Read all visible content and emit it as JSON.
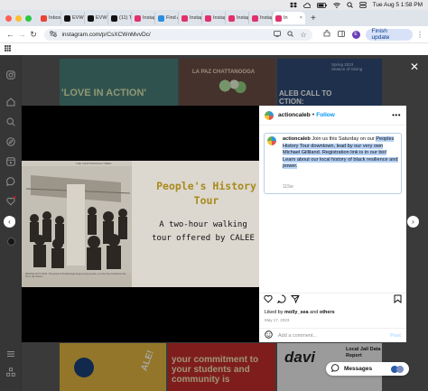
{
  "menubar": {
    "date_time": "Tue Aug 5  1:58 PM"
  },
  "tabs": [
    {
      "label": "Inbox",
      "fav_color": "#ea4335",
      "fav_icon": "gmail-icon"
    },
    {
      "label": "EVW",
      "fav_color": "#111111",
      "fav_icon": "x-icon"
    },
    {
      "label": "EVW",
      "fav_color": "#111111",
      "fav_icon": "x-icon"
    },
    {
      "label": "(11) Tr",
      "fav_color": "#111111",
      "fav_icon": "x-icon"
    },
    {
      "label": "Instag",
      "fav_color": "#e1306c",
      "fav_icon": "instagram-icon"
    },
    {
      "label": "Find A",
      "fav_color": "#2a8ee0",
      "fav_icon": "globe-icon"
    },
    {
      "label": "Instag",
      "fav_color": "#e1306c",
      "fav_icon": "instagram-icon"
    },
    {
      "label": "Instag",
      "fav_color": "#e1306c",
      "fav_icon": "instagram-icon"
    },
    {
      "label": "Instag",
      "fav_color": "#e1306c",
      "fav_icon": "instagram-icon"
    },
    {
      "label": "Instag",
      "fav_color": "#e1306c",
      "fav_icon": "instagram-icon"
    },
    {
      "label": "In",
      "fav_color": "#e1306c",
      "fav_icon": "instagram-icon",
      "active": true
    }
  ],
  "address": {
    "url": "instagram.com/p/CsXCWnMvvDc/",
    "profile_letter": "E",
    "finish_label": "Finish update"
  },
  "background": {
    "tile1_text": "'LOVE IN ACTION'",
    "tile2_text": "LA PAZ CHATTANOOGA",
    "tile3_text": "ALEB CALL TO CTION:",
    "tile3_small": "Spring 2023 Season of Giving",
    "tile4_text": "your commitment to your students and community is",
    "tile5_text": "ALE!",
    "tile6_text": "davi",
    "tile6_label": "Local Jail Data Report"
  },
  "post": {
    "username": "actioncaleb",
    "follow": "Follow",
    "more": "•••",
    "caption_user": "actioncaleb",
    "caption_plain": " Join us this Saturday on our ",
    "caption_selected": "Peoples History Tour downtown, lead by our very own Michael Gilliland. Registration link is in our bio! Learn about our local history of black resilience and power.",
    "age": "115w",
    "image_title": "People's History Tour",
    "image_subtitle": "A two-hour walking tour offered by CALEE",
    "image_newspaper": "THE CHATTANOOGA TIMES",
    "image_photo_caption": "PEOPLE ON TV BUS. This group of Chattanooga Negro young people, on a bus they boarded at the Flynn Tap Station...",
    "liked_prefix": "Liked by ",
    "liked_user": "molly_sea",
    "liked_mid": " and ",
    "liked_others": "others",
    "date": "May 17, 2023",
    "comment_placeholder": "Add a comment...",
    "post_label": "Post"
  },
  "messages": {
    "label": "Messages"
  }
}
